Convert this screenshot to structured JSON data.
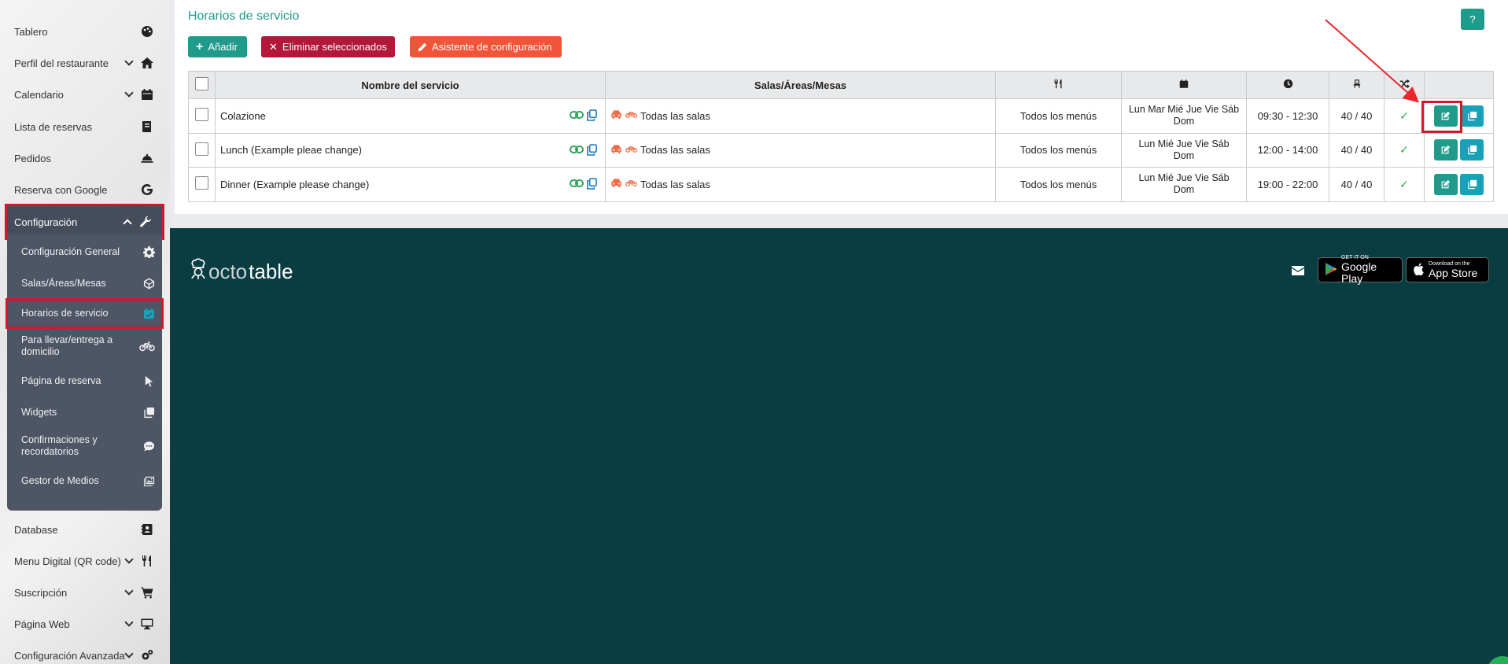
{
  "sidebar": {
    "items": [
      {
        "label": "Tablero",
        "icon": "palette-icon"
      },
      {
        "label": "Perfil del restaurante",
        "icon": "home-icon",
        "chevron": true
      },
      {
        "label": "Calendario",
        "icon": "calendar-icon",
        "chevron": true
      },
      {
        "label": "Lista de reservas",
        "icon": "book-icon"
      },
      {
        "label": "Pedidos",
        "icon": "cloche-icon"
      },
      {
        "label": "Reserva con Google",
        "icon": "google-icon"
      },
      {
        "label": "Configuración",
        "icon": "wrench-icon",
        "chevron": true
      }
    ],
    "submenu": [
      {
        "label": "Configuración General",
        "icon": "gear-icon"
      },
      {
        "label": "Salas/Áreas/Mesas",
        "icon": "cube-icon"
      },
      {
        "label": "Horarios de servicio",
        "icon": "calendar-check-icon"
      },
      {
        "label": "Para llevar/entrega a domicilio",
        "icon": "bicycle-icon"
      },
      {
        "label": "Página de reserva",
        "icon": "pointer-icon"
      },
      {
        "label": "Widgets",
        "icon": "copy-icon"
      },
      {
        "label": "Confirmaciones y recordatorios",
        "icon": "comment-icon"
      },
      {
        "label": "Gestor de Medios",
        "icon": "image-icon"
      }
    ],
    "bottom_items": [
      {
        "label": "Database",
        "icon": "contact-icon"
      },
      {
        "label": "Menu Digital (QR code)",
        "icon": "utensils-icon",
        "chevron": true
      },
      {
        "label": "Suscripción",
        "icon": "cart-icon",
        "chevron": true
      },
      {
        "label": "Página Web",
        "icon": "monitor-icon",
        "chevron": true
      },
      {
        "label": "Configuración Avanzada",
        "icon": "gears-icon",
        "chevron": true
      }
    ]
  },
  "main": {
    "title": "Horarios de servicio",
    "help_label": "?",
    "toolbar": {
      "add_label": "Añadir",
      "delete_label": "Eliminar seleccionados",
      "wizard_label": "Asistente de configuración"
    },
    "table": {
      "headers": {
        "name": "Nombre del servicio",
        "salas": "Salas/Áreas/Mesas",
        "menu_icon": "utensils-icon",
        "days_icon": "calendar-icon",
        "time_icon": "clock-icon",
        "capacity_icon": "chair-icon",
        "shuffle_icon": "shuffle-icon"
      },
      "rows": [
        {
          "name": "Colazione",
          "salas": "Todas las salas",
          "menus": "Todos los menús",
          "days": "Lun Mar Mié Jue Vie Sáb Dom",
          "time": "09:30 - 12:30",
          "capacity": "40 / 40",
          "active": true
        },
        {
          "name": "Lunch (Example pleae change)",
          "salas": "Todas las salas",
          "menus": "Todos los menús",
          "days": "Lun Mié Jue Vie Sáb Dom",
          "time": "12:00 - 14:00",
          "capacity": "40 / 40",
          "active": true
        },
        {
          "name": "Dinner (Example please change)",
          "salas": "Todas las salas",
          "menus": "Todos los menús",
          "days": "Lun Mié Jue Vie Sáb Dom",
          "time": "19:00 - 22:00",
          "capacity": "40 / 40",
          "active": true
        }
      ]
    }
  },
  "footer": {
    "logo_part1": "octo",
    "logo_part2": "table",
    "google_small": "GET IT ON",
    "google_big": "Google Play",
    "apple_small": "Download on the",
    "apple_big": "App Store"
  },
  "colors": {
    "accent": "#1f9b8c",
    "danger": "#b3173a",
    "warning": "#f0553a",
    "info": "#17a2b8",
    "footer_bg": "#093d42",
    "highlight": "#d3182b"
  }
}
